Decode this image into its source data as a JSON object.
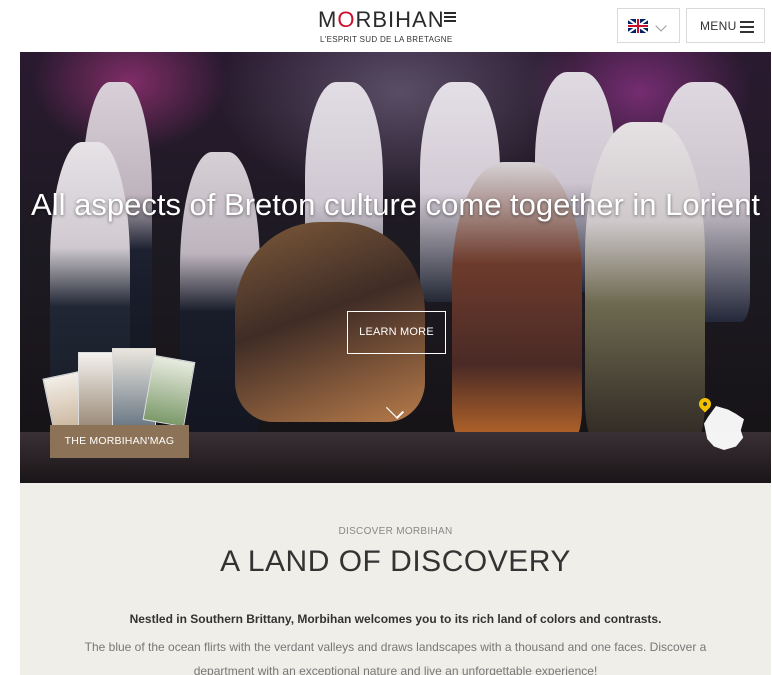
{
  "header": {
    "logo_word_pre": "M",
    "logo_word_o": "O",
    "logo_word_post": "RBIHAN",
    "logo_tagline": "L'ESPRIT SUD DE LA BRETAGNE",
    "language_flag": "uk-flag-icon",
    "menu_label": "MENU"
  },
  "hero": {
    "title": "All aspects of Breton culture come together in Lorient",
    "cta_label": "LEARN MORE",
    "mag_button_label": "THE MORBIHAN'MAG",
    "scroll_icon": "chevron-down-icon",
    "map_pin_icon": "map-pin-icon"
  },
  "discover": {
    "kicker": "DISCOVER MORBIHAN",
    "title": "A LAND OF DISCOVERY",
    "lead": "Nestled in Southern Brittany, Morbihan welcomes you to its rich land of colors and contrasts.",
    "body": "The blue of the ocean flirts with the verdant valleys and draws landscapes with a thousand and one faces. Discover a department with an exceptional nature and live an unforgettable experience!"
  },
  "colors": {
    "accent_red": "#c8102e",
    "mag_button": "#8c7257",
    "section_bg": "#f0eee8",
    "pin": "#f2c200"
  }
}
